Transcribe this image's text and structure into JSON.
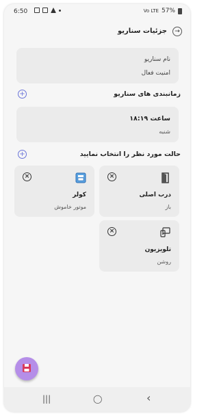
{
  "status_bar": {
    "time": "6:50",
    "battery": "57%",
    "signal": "Vo LTE"
  },
  "header": {
    "title": "جزئیات سناریو"
  },
  "info_card": {
    "line1": "نام سناریو",
    "line2": "امنیت فعال"
  },
  "schedule_section": {
    "title": "زمانبندی های سناریو",
    "time": "ساعت ۱۸:۱۹",
    "day": "شنبه"
  },
  "states_section": {
    "title": "حالت مورد نظر را انتخاب نمایید"
  },
  "devices": [
    {
      "name": "درب اصلی",
      "state": "باز",
      "icon": "door-icon"
    },
    {
      "name": "کولر",
      "state": "موتور خاموش",
      "icon": "cooler-icon"
    },
    {
      "name": "تلویزیون",
      "state": "روشن",
      "icon": "tv-icon"
    }
  ],
  "fab": {
    "icon": "save-icon",
    "color": "#b58ee8"
  },
  "navbar": {
    "recent": "|||",
    "home": "◯",
    "back": "‹"
  }
}
